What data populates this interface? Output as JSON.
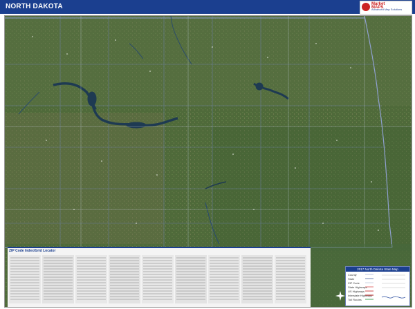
{
  "header": {
    "title": "NORTH DAKOTA"
  },
  "logo": {
    "line1": "Market",
    "line2": "MAPS",
    "sub": "Advanced Map Solutions"
  },
  "index": {
    "title": "ZIP Code Index/Grid Locator"
  },
  "legend": {
    "title": "2017 North Dakota State Map",
    "items": [
      "County",
      "State",
      "ZIP Code",
      "State Highways",
      "US Highways",
      "Interstate Highways",
      "Toll Routes"
    ]
  },
  "colors": {
    "header_bg": "#1b3f8f",
    "map_green": "#4f6a3a",
    "water": "#1e3a52",
    "county_lines": "#6f82b0",
    "road_red": "#d33a3a"
  },
  "icons": [
    "logo-mark-icon",
    "compass-icon"
  ]
}
